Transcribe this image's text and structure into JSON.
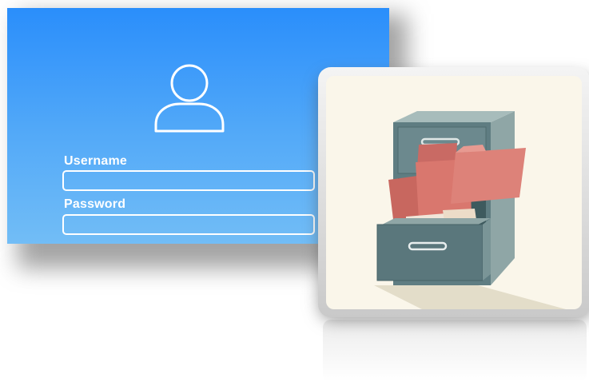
{
  "login_form": {
    "username_label": "Username",
    "password_label": "Password",
    "username_value": "",
    "password_value": ""
  },
  "icons": {
    "user": "user-icon",
    "cabinet": "file-cabinet-icon"
  },
  "colors": {
    "panel_top": "#2a8efb",
    "panel_bottom": "#72bdf6",
    "cabinet": "#5d7b80",
    "folder": "#d9776e",
    "card_background": "#faf6ea"
  }
}
